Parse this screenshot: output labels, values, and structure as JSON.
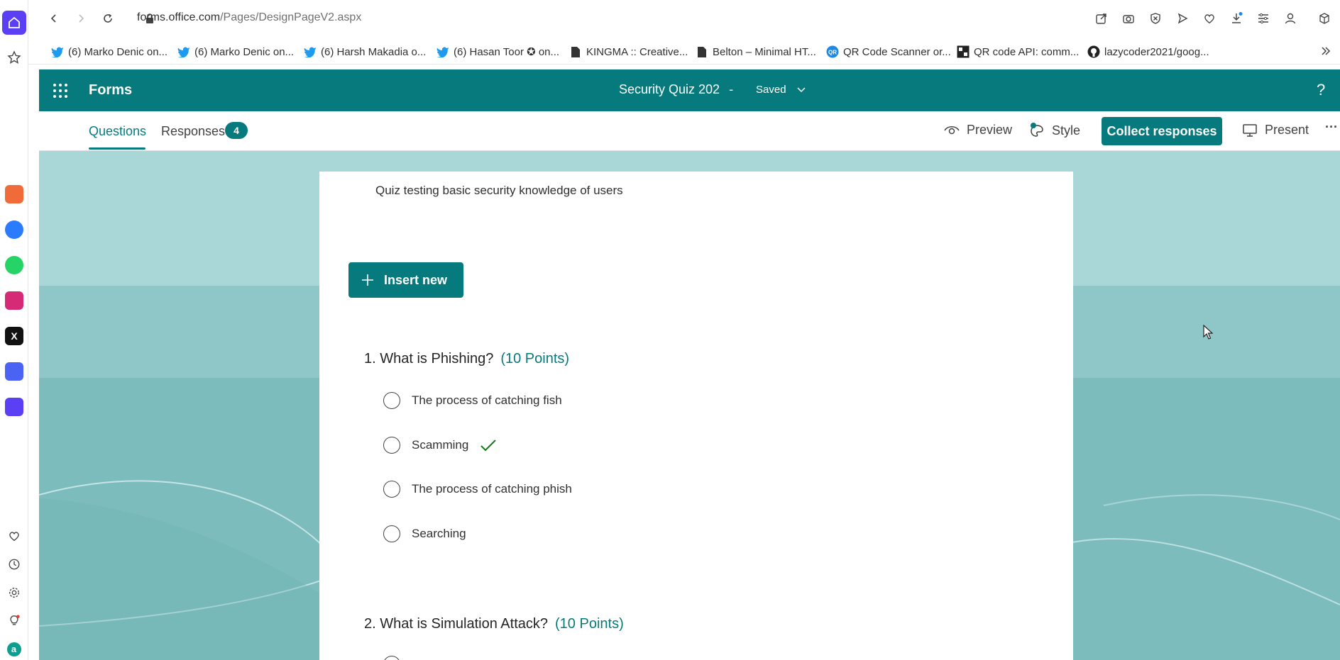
{
  "browser": {
    "url_domain": "forms.office.com",
    "url_path": "/Pages/DesignPageV2.aspx",
    "bookmarks": [
      "(6) Marko Denic on...",
      "(6) Marko Denic on...",
      "(6) Harsh Makadia o...",
      "(6) Hasan Toor ✪ on...",
      "KINGMA :: Creative...",
      "Belton – Minimal HT...",
      "QR Code Scanner or...",
      "QR code API: comm...",
      "lazycoder2021/goog..."
    ]
  },
  "header": {
    "app_name": "Forms",
    "form_title": "Security Quiz 202",
    "separator": "-",
    "status": "Saved",
    "help": "?"
  },
  "toolbar": {
    "tab_questions": "Questions",
    "tab_responses": "Responses",
    "responses_count": "4",
    "preview": "Preview",
    "style": "Style",
    "collect": "Collect responses",
    "present": "Present",
    "more": "···"
  },
  "form": {
    "description": "Quiz testing basic security knowledge of users",
    "insert_new": "Insert new",
    "questions": [
      {
        "title": "1. What is Phishing?",
        "points": "(10 Points)",
        "options": [
          {
            "label": "The process of catching fish",
            "correct": false
          },
          {
            "label": "Scamming",
            "correct": true
          },
          {
            "label": "The process of catching phish",
            "correct": false
          },
          {
            "label": "Searching",
            "correct": false
          }
        ]
      },
      {
        "title": "2. What is Simulation Attack?",
        "points": "(10 Points)"
      }
    ]
  },
  "colors": {
    "teal": "#077a7d",
    "canvas": "#a9d6d6",
    "sidebar_home": "#5b3ff5"
  }
}
